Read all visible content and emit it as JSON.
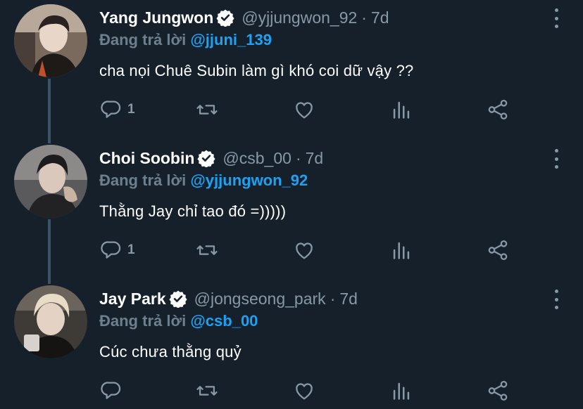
{
  "replying_prefix": "Đang trả lời",
  "tweets": [
    {
      "name": "Yang Jungwon",
      "handle": "@yjjungwon_92",
      "time": "7d",
      "reply_to": "@jjuni_139",
      "text": "cha nọi Chuê Subin làm gì khó coi dữ vậy ??",
      "reply_count": "1",
      "verified": true
    },
    {
      "name": "Choi Soobin",
      "handle": "@csb_00",
      "time": "7d",
      "reply_to": "@yjjungwon_92",
      "text": "Thằng Jay chỉ tao đó =)))))",
      "reply_count": "1",
      "verified": true
    },
    {
      "name": "Jay Park",
      "handle": "@jongseong_park",
      "time": "7d",
      "reply_to": "@csb_00",
      "text": "Cúc chưa thằng quỷ",
      "reply_count": "",
      "verified": true
    }
  ],
  "separator": "·",
  "colors": {
    "background": "#15202b",
    "secondary_text": "#8899a6",
    "accent": "#1da1f2",
    "thread_line": "#3d5466"
  },
  "icons": [
    "reply-icon",
    "retweet-icon",
    "like-icon",
    "analytics-icon",
    "share-icon",
    "more-icon",
    "verified-badge-icon"
  ]
}
